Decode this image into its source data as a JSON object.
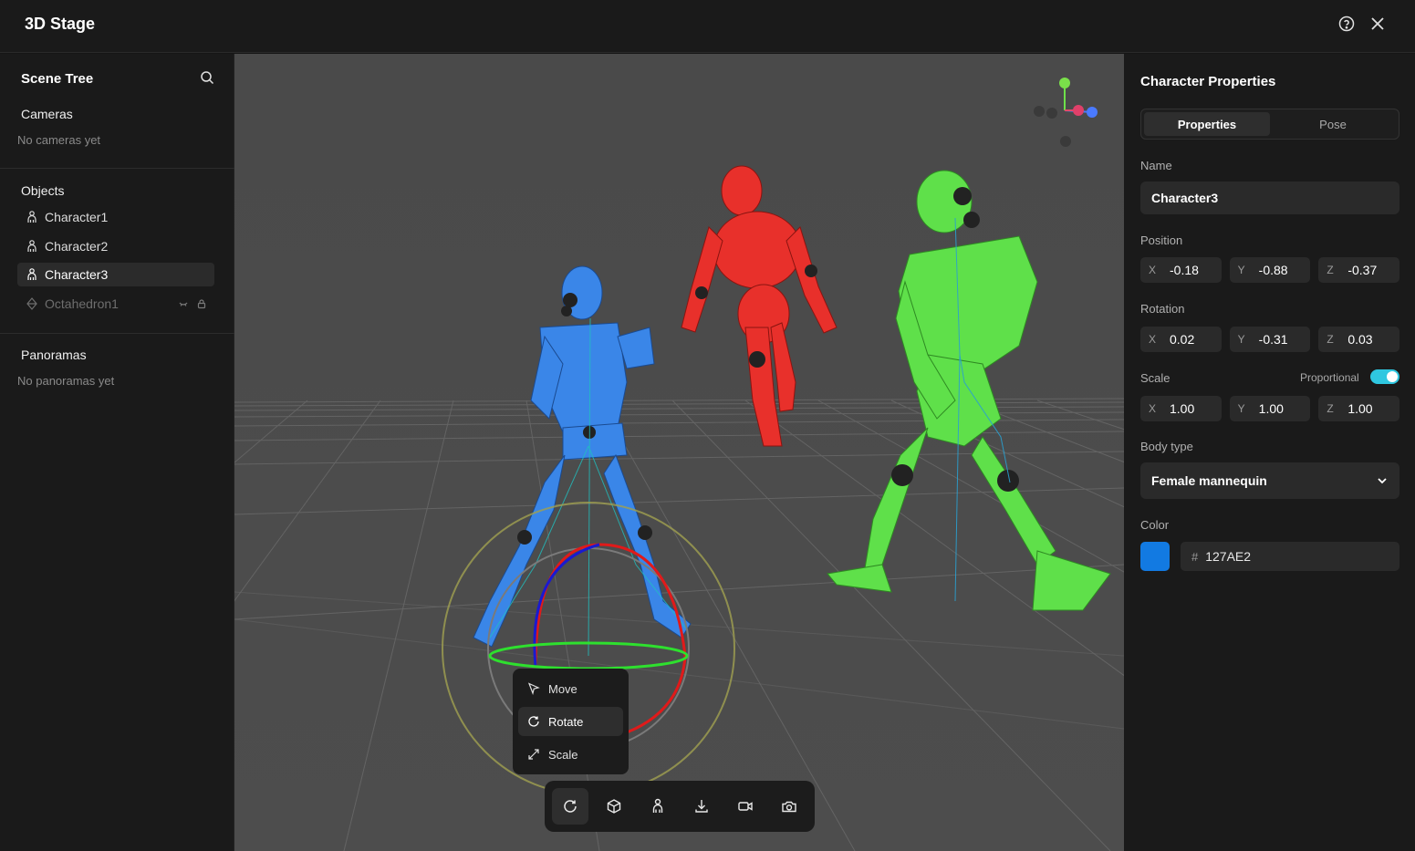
{
  "app": {
    "title": "3D Stage"
  },
  "sidebar": {
    "title": "Scene Tree",
    "cameras": {
      "title": "Cameras",
      "empty": "No cameras yet"
    },
    "objects": {
      "title": "Objects",
      "items": [
        {
          "label": "Character1",
          "icon": "person-icon"
        },
        {
          "label": "Character2",
          "icon": "person-icon"
        },
        {
          "label": "Character3",
          "icon": "person-icon",
          "selected": true
        },
        {
          "label": "Octahedron1",
          "icon": "octahedron-icon",
          "hidden": true,
          "locked": true
        }
      ]
    },
    "panoramas": {
      "title": "Panoramas",
      "empty": "No panoramas yet"
    }
  },
  "gizmo_menu": {
    "items": [
      {
        "label": "Move",
        "icon": "cursor-icon"
      },
      {
        "label": "Rotate",
        "icon": "rotate-icon",
        "active": true
      },
      {
        "label": "Scale",
        "icon": "scale-icon"
      }
    ]
  },
  "toolbar": {
    "buttons": [
      "rotate-icon",
      "cube-icon",
      "person-icon",
      "download-icon",
      "video-camera-icon",
      "camera-icon"
    ],
    "active": "rotate-icon"
  },
  "panel": {
    "title": "Character Properties",
    "tabs": [
      {
        "label": "Properties",
        "active": true
      },
      {
        "label": "Pose"
      }
    ],
    "name": {
      "label": "Name",
      "value": "Character3"
    },
    "position": {
      "label": "Position",
      "x": "-0.18",
      "y": "-0.88",
      "z": "-0.37"
    },
    "rotation": {
      "label": "Rotation",
      "x": "0.02",
      "y": "-0.31",
      "z": "0.03"
    },
    "scale": {
      "label": "Scale",
      "proportional_label": "Proportional",
      "proportional": true,
      "x": "1.00",
      "y": "1.00",
      "z": "1.00"
    },
    "axis_labels": {
      "x": "X",
      "y": "Y",
      "z": "Z"
    },
    "body_type": {
      "label": "Body type",
      "value": "Female mannequin"
    },
    "color": {
      "label": "Color",
      "hash": "#",
      "value": "127AE2",
      "swatch": "#127AE2"
    }
  },
  "colors": {
    "accent_toggle": "#2fc7e0",
    "character_blue": "#3a86e8",
    "character_red": "#e8302b",
    "character_green": "#5fe04a",
    "axis_x": "#e03030",
    "axis_y": "#2ee02e",
    "axis_z": "#1a2be0"
  }
}
